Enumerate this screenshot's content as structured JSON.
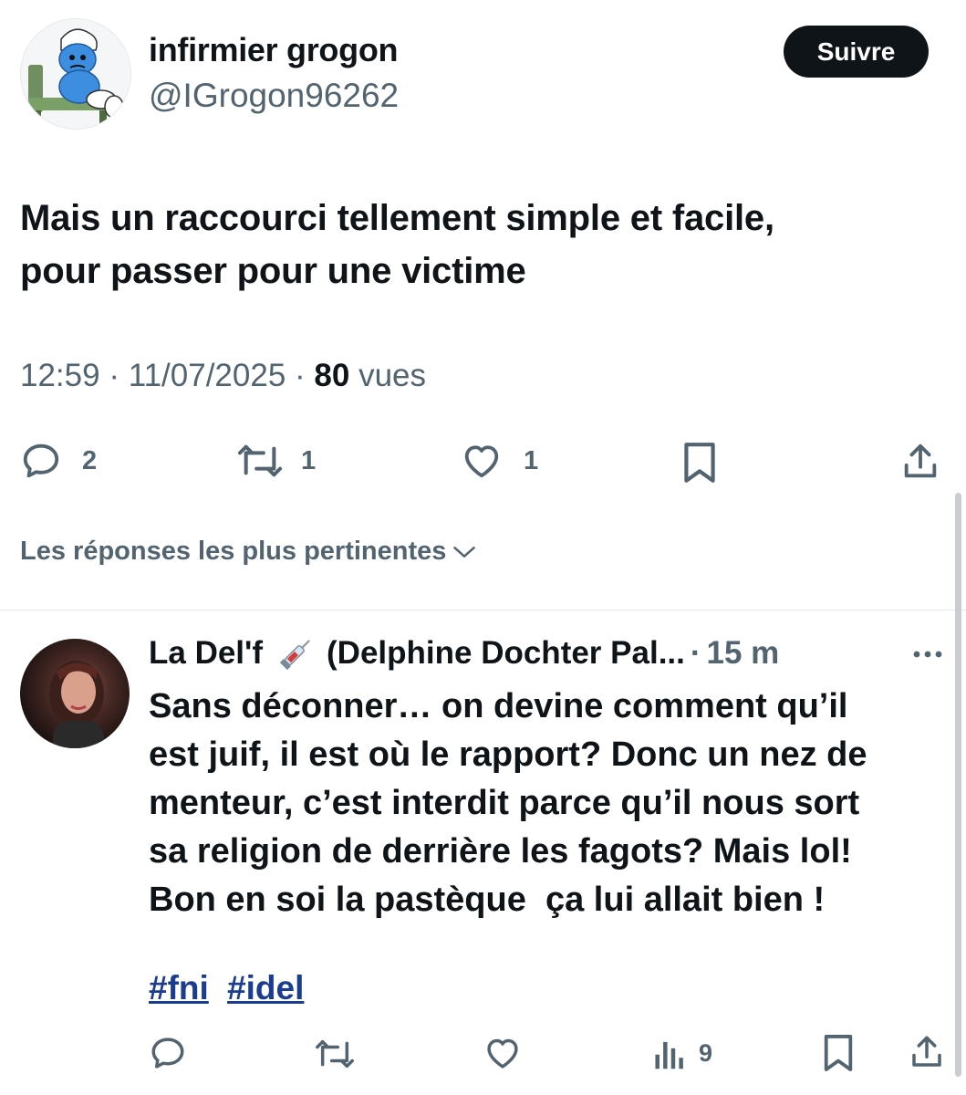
{
  "tweet": {
    "author_name": "infirmier grogon",
    "author_handle": "@IGrogon96262",
    "follow_label": "Suivre",
    "text_line1": "Mais un raccourci tellement simple et facile,",
    "text_line2": "pour passer pour une victime",
    "time": "12:59",
    "date": "11/07/2025",
    "views_count": "80",
    "views_label": "vues",
    "separator": "·",
    "actions": {
      "replies": "2",
      "retweets": "1",
      "likes": "1"
    }
  },
  "replies_sort": {
    "label": "Les réponses les plus pertinentes"
  },
  "reply": {
    "author_name": "La Del'f",
    "author_name_rest": "(Delphine Dochter Pal...",
    "time": "15 m",
    "lines": [
      "Sans déconner… on devine comment qu’il",
      "est juif, il est où le rapport? Donc un nez de",
      "menteur, c’est interdit parce qu’il nous sort",
      "sa religion de derrière les fagots? Mais lol!",
      "Bon en soi la pastèque  ça lui allait bien !"
    ],
    "hashtags": [
      "#fni",
      "#idel"
    ],
    "views": "9"
  },
  "icons": {
    "avatar_main": "smurf-avatar",
    "reply": "reply-icon",
    "retweet": "retweet-icon",
    "like": "heart-icon",
    "bookmark": "bookmark-icon",
    "share": "share-icon",
    "views": "views-chart-icon",
    "more": "more-dots-icon",
    "syringe": "syringe-emoji",
    "chevron": "chevron-down-icon"
  },
  "colors": {
    "text": "#0f1419",
    "secondary": "#536471",
    "button_bg": "#0f1419",
    "hashtag": "#1a3d8f"
  }
}
